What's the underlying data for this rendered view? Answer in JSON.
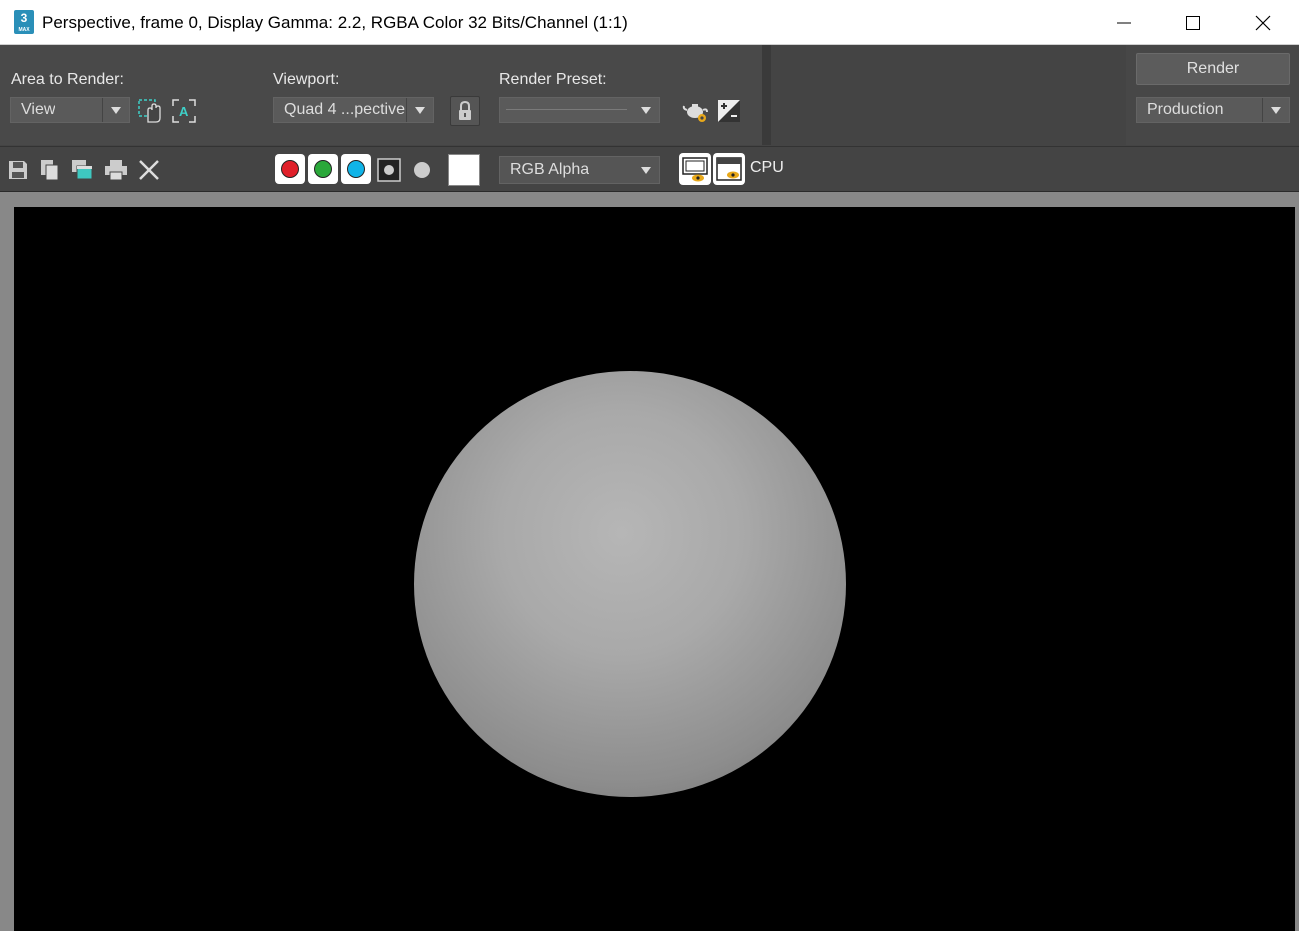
{
  "window": {
    "title": "Perspective, frame 0, Display Gamma: 2.2, RGBA Color 32 Bits/Channel (1:1)",
    "app_icon_number": "3",
    "app_icon_sub": "MAX"
  },
  "render_setup": {
    "area_label": "Area to Render:",
    "area_value": "View",
    "viewport_label": "Viewport:",
    "viewport_value": "Quad 4 ...pective",
    "preset_label": "Render Preset:",
    "preset_value": "",
    "render_button": "Render",
    "mode_value": "Production"
  },
  "toolbar": {
    "channel_display": "RGB Alpha",
    "renderer_label": "CPU",
    "colors": {
      "red": "#e0202a",
      "green": "#2aa83a",
      "blue": "#10b4e8"
    }
  }
}
